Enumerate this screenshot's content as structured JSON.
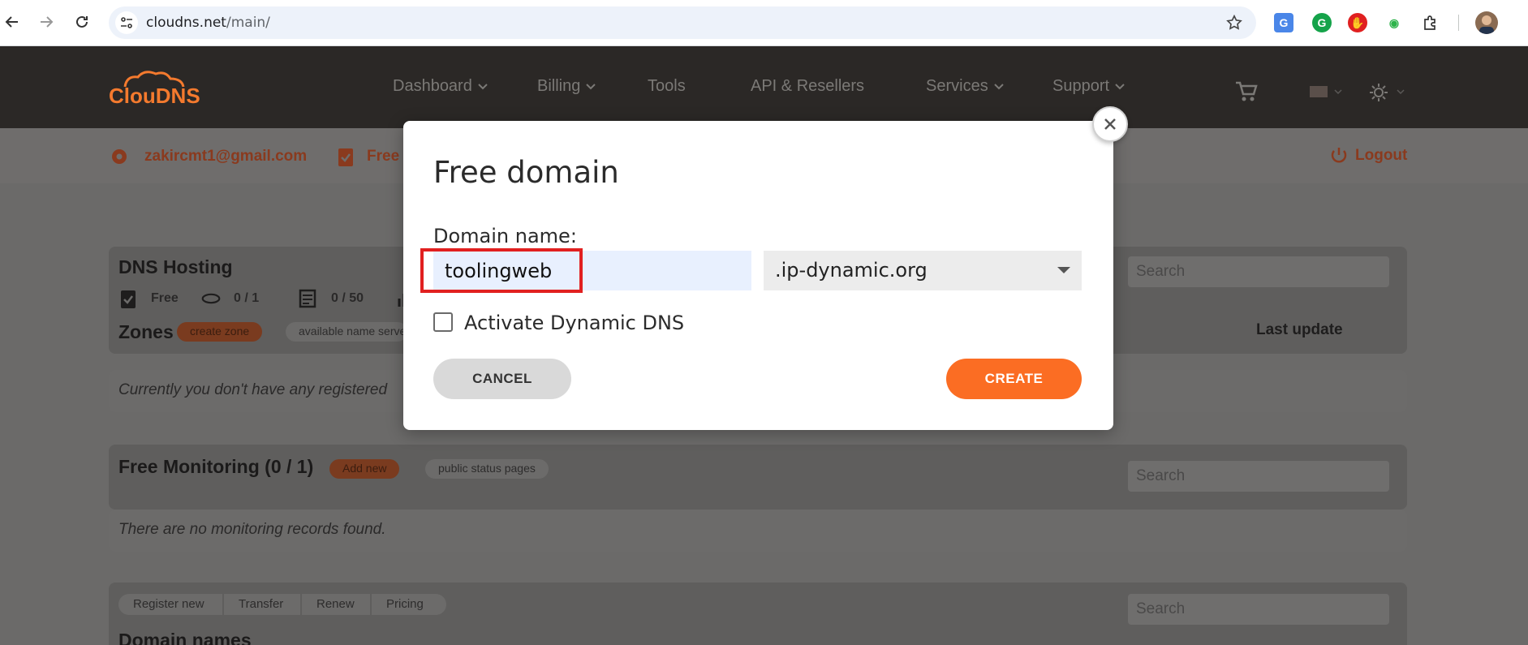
{
  "browser": {
    "url_host": "cloudns.net",
    "url_path": "/main/"
  },
  "header": {
    "logo_text": "ClouDNS",
    "nav": [
      "Dashboard",
      "Billing",
      "Tools",
      "API & Resellers",
      "Services",
      "Support"
    ]
  },
  "subheader": {
    "email": "zakircmt1@gmail.com",
    "plan": "Free",
    "logout": "Logout"
  },
  "dns_panel": {
    "title": "DNS Hosting",
    "stat_free": "Free",
    "stat_zones": "0 / 1",
    "stat_records": "0 / 50",
    "zones_label": "Zones",
    "create_zone": "create zone",
    "available_ns": "available name servers",
    "last_update": "Last update",
    "empty_text": "Currently you don't have any registered",
    "search_placeholder": "Search"
  },
  "monitoring_panel": {
    "title": "Free Monitoring (0 / 1)",
    "add_new": "Add new",
    "status_pages": "public status pages",
    "empty_text": "There are no monitoring records found.",
    "search_placeholder": "Search"
  },
  "domains_panel": {
    "tabs": [
      "Register new",
      "Transfer",
      "Renew",
      "Pricing"
    ],
    "title": "Domain names",
    "search_placeholder": "Search"
  },
  "modal": {
    "title": "Free domain",
    "domain_label": "Domain name:",
    "domain_value": "toolingweb",
    "tld_selected": ".ip-dynamic.org",
    "dynamic_dns_label": "Activate Dynamic DNS",
    "dynamic_dns_checked": false,
    "cancel_label": "CANCEL",
    "create_label": "CREATE"
  },
  "colors": {
    "accent": "#fb6d23",
    "header_bg": "#2b2826",
    "highlight": "#e12020"
  }
}
